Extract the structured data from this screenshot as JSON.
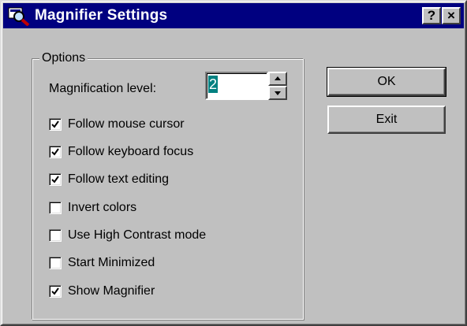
{
  "window": {
    "title": "Magnifier Settings",
    "help_label": "?",
    "close_label": "×",
    "app_icon": "magnifier-icon"
  },
  "options": {
    "group_title": "Options",
    "magnification_label": "Magnification level:",
    "magnification_value": "2",
    "items": [
      {
        "label": "Follow mouse cursor",
        "checked": true
      },
      {
        "label": "Follow keyboard focus",
        "checked": true
      },
      {
        "label": "Follow text editing",
        "checked": true
      },
      {
        "label": "Invert colors",
        "checked": false
      },
      {
        "label": "Use High Contrast mode",
        "checked": false
      },
      {
        "label": "Start Minimized",
        "checked": false
      },
      {
        "label": "Show Magnifier",
        "checked": true
      }
    ]
  },
  "buttons": {
    "ok_label": "OK",
    "exit_label": "Exit"
  },
  "colors": {
    "titlebar": "#000080",
    "face": "#c0c0c0",
    "selection": "#008080"
  }
}
